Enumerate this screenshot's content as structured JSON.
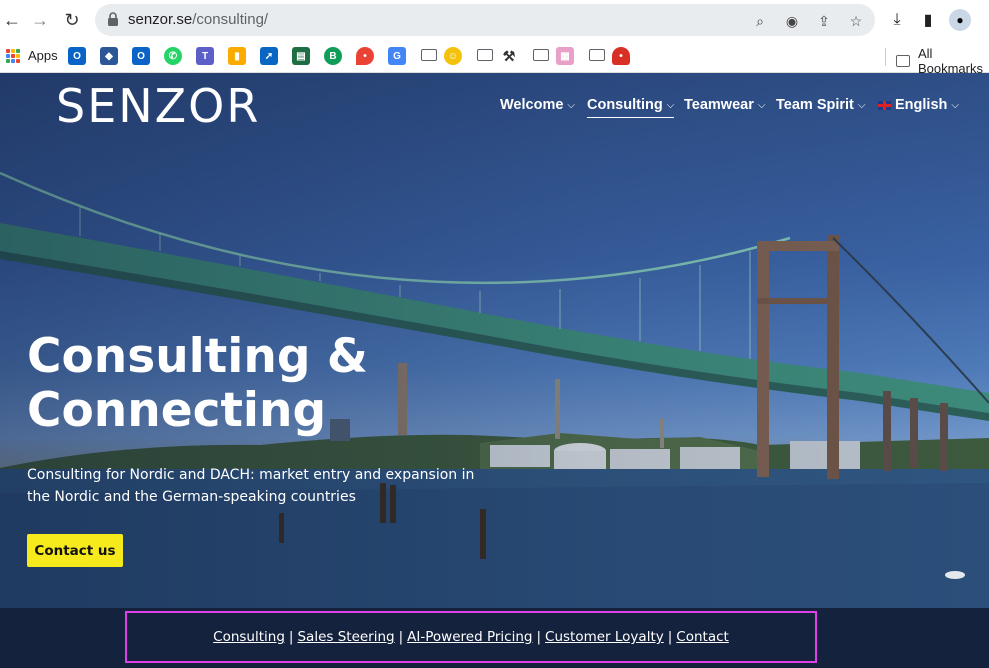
{
  "browser": {
    "url_host": "senzor.se",
    "url_path": "/consulting/",
    "bookmarks": {
      "apps_label": "Apps",
      "all_bookmarks_label": "All Bookmarks"
    }
  },
  "site": {
    "logo": "SENZOR",
    "nav": [
      {
        "label": "Welcome"
      },
      {
        "label": "Consulting"
      },
      {
        "label": "Teamwear"
      },
      {
        "label": "Team Spirit"
      },
      {
        "label": "English"
      }
    ],
    "hero": {
      "headline_line1": "Consulting &",
      "headline_line2": "Connecting",
      "subline": "Consulting for Nordic and DACH: market entry and expansion in the Nordic and the German-speaking countries",
      "cta_label": "Contact us"
    },
    "footer_links": [
      {
        "label": "Consulting"
      },
      {
        "label": "Sales Steering"
      },
      {
        "label": "AI-Powered Pricing"
      },
      {
        "label": "Customer Loyalty"
      },
      {
        "label": "Contact"
      }
    ]
  },
  "colors": {
    "cta": "#f7ea1c",
    "footer_bg": "#15223d",
    "highlight_border": "#e040e8"
  }
}
